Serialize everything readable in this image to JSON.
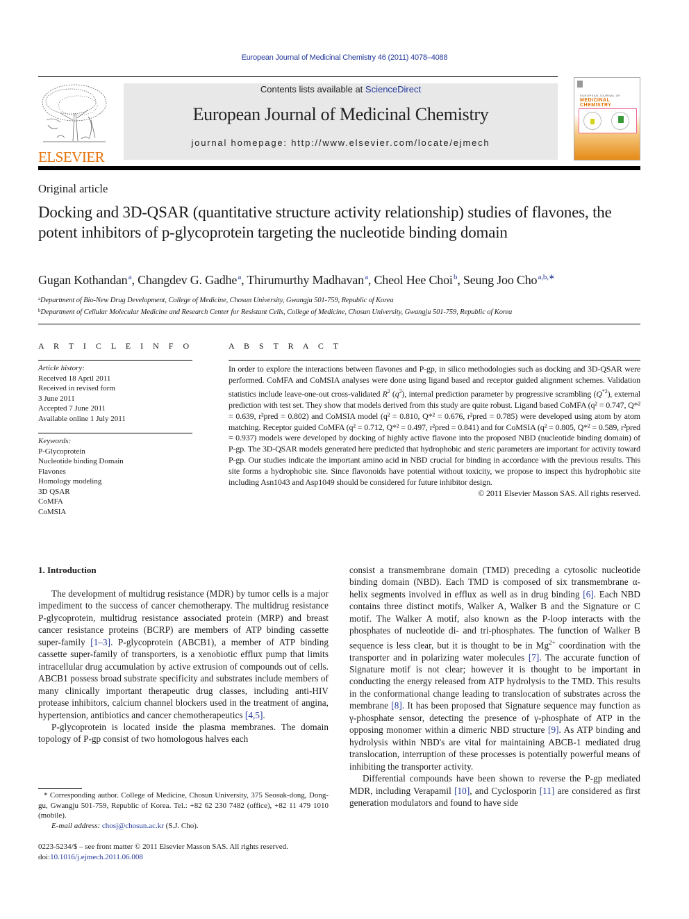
{
  "header": {
    "citation": "European Journal of Medicinal Chemistry 46 (2011) 4078–4088",
    "contents_prefix": "Contents lists available at ",
    "contents_link": "ScienceDirect",
    "journal_title": "European Journal of Medicinal Chemistry",
    "homepage": "journal homepage: http://www.elsevier.com/locate/ejmech",
    "publisher_logo_text": "ELSEVIER",
    "cover_title_small": "EUROPEAN JOURNAL OF",
    "cover_title_line1": "MEDICINAL",
    "cover_title_line2": "CHEMISTRY"
  },
  "article": {
    "type": "Original article",
    "title": "Docking and 3D-QSAR (quantitative structure activity relationship) studies of flavones, the potent inhibitors of p-glycoprotein targeting the nucleotide binding domain",
    "authors": [
      {
        "name": "Gugan Kothandan",
        "sup": "a"
      },
      {
        "name": "Changdev G. Gadhe",
        "sup": "a"
      },
      {
        "name": "Thirumurthy Madhavan",
        "sup": "a"
      },
      {
        "name": "Cheol Hee Choi",
        "sup": "b"
      },
      {
        "name": "Seung Joo Cho",
        "sup": "a,b,∗"
      }
    ],
    "affiliations": [
      {
        "sup": "a",
        "text": "Department of Bio-New Drug Development, College of Medicine, Chosun University, Gwangju 501-759, Republic of Korea"
      },
      {
        "sup": "b",
        "text": "Department of Cellular Molecular Medicine and Research Center for Resistant Cells, College of Medicine, Chosun University, Gwangju 501-759, Republic of Korea"
      }
    ]
  },
  "article_info": {
    "heading": "A R T I C L E   I N F O",
    "history_label": "Article history:",
    "history": [
      "Received 18 April 2011",
      "Received in revised form",
      "3 June 2011",
      "Accepted 7 June 2011",
      "Available online 1 July 2011"
    ],
    "keywords_label": "Keywords:",
    "keywords": [
      "P-Glycoprotein",
      "Nucleotide binding Domain",
      "Flavones",
      "Homology modeling",
      "3D QSAR",
      "CoMFA",
      "CoMSIA"
    ]
  },
  "abstract": {
    "heading": "A B S T R A C T",
    "p1": "In order to explore the interactions between flavones and P-gp, in silico methodologies such as docking and 3D-QSAR were performed. CoMFA and CoMSIA analyses were done using ligand based and receptor guided alignment schemes. Validation statistics include leave-one-out cross-validated ",
    "r2": "R",
    "p2": " (",
    "q2a": "q",
    "p3": "), internal prediction parameter by progressive scrambling (",
    "Q2a": "Q",
    "p4": "), external prediction with test set. They show that models derived from this study are quite robust. Ligand based CoMFA (q² = 0.747, Q*² = 0.639, r²pred = 0.802) and CoMSIA model (q² = 0.810, Q*² = 0.676, r²pred = 0.785) were developed using atom by atom matching. Receptor guided CoMFA (q² = 0.712, Q*² = 0.497, r²pred = 0.841) and for CoMSIA (q² = 0.805, Q*² = 0.589, r²pred = 0.937) models were developed by docking of highly active flavone into the proposed NBD (nucleotide binding domain) of P-gp. The 3D-QSAR models generated here predicted that hydrophobic and steric parameters are important for activity toward P-gp. Our studies indicate the important amino acid in NBD crucial for binding in accordance with the previous results. This site forms a hydrophobic site. Since flavonoids have potential without toxicity, we propose to inspect this hydrophobic site including Asn1043 and Asp1049 should be considered for future inhibitor design.",
    "stats": {
      "ligand_comfa": {
        "q2": 0.747,
        "Q_star2": 0.639,
        "r2_pred": 0.802
      },
      "ligand_comsia": {
        "q2": 0.81,
        "Q_star2": 0.676,
        "r2_pred": 0.785
      },
      "receptor_comfa": {
        "q2": 0.712,
        "Q_star2": 0.497,
        "r2_pred": 0.841
      },
      "receptor_comsia": {
        "q2": 0.805,
        "Q_star2": 0.589,
        "r2_pred": 0.937
      }
    },
    "copyright": "© 2011 Elsevier Masson SAS. All rights reserved."
  },
  "introduction": {
    "heading": "1.  Introduction",
    "left": {
      "p1_a": "The development of multidrug resistance (MDR) by tumor cells is a major impediment to the success of cancer chemotherapy. The multidrug resistance P-glycoprotein, multidrug resistance associated protein (MRP) and breast cancer resistance proteins (BCRP) are members of ATP binding cassette super-family ",
      "ref1": "[1–3]",
      "p1_b": ". P-glycoprotein (ABCB1), a member of ATP binding cassette super-family of transporters, is a xenobiotic efflux pump that limits intracellular drug accumulation by active extrusion of compounds out of cells. ABCB1 possess broad substrate specificity and substrates include members of many clinically important therapeutic drug classes, including anti-HIV protease inhibitors, calcium channel blockers used in the treatment of angina, hypertension, antibiotics and cancer chemotherapeutics ",
      "ref2": "[4,5]",
      "p1_c": ".",
      "p2": "P-glycoprotein is located inside the plasma membranes. The domain topology of P-gp consist of two homologous halves each"
    },
    "right": {
      "a": "consist a transmembrane domain (TMD) preceding a cytosolic nucleotide binding domain (NBD). Each TMD is composed of six transmembrane α-helix segments involved in efflux as well as in drug binding ",
      "ref6": "[6]",
      "b": ". Each NBD contains three distinct motifs, Walker A, Walker B and the Signature or C motif. The Walker A motif, also known as the P-loop interacts with the phosphates of nucleotide di- and tri-phosphates. The function of Walker B sequence is less clear, but it is thought to be in Mg",
      "mg_sup": "2+",
      "c": " coordination with the transporter and in polarizing water molecules ",
      "ref7": "[7]",
      "d": ". The accurate function of Signature motif is not clear; however it is thought to be important in conducting the energy released from ATP hydrolysis to the TMD. This results in the conformational change leading to translocation of substrates across the membrane ",
      "ref8": "[8]",
      "e": ". It has been proposed that Signature sequence may function as γ-phosphate sensor, detecting the presence of γ-phosphate of ATP in the opposing monomer within a dimeric NBD structure ",
      "ref9": "[9]",
      "f": ". As ATP binding and hydrolysis within NBD's are vital for maintaining ABCB-1 mediated drug translocation, interruption of these processes is potentially powerful means of inhibiting the transporter activity.",
      "p2_a": "Differential compounds have been shown to reverse the P-gp mediated MDR, including Verapamil ",
      "ref10": "[10]",
      "p2_b": ", and Cyclosporin ",
      "ref11": "[11]",
      "p2_c": " are considered as first generation modulators and found to have side"
    }
  },
  "footnote": {
    "corresponding": "* Corresponding author. College of Medicine, Chosun University, 375 Seosuk-dong, Dong-gu, Gwangju 501-759, Republic of Korea. Tel.: +82 62 230 7482 (office), +82 11 479 1010 (mobile).",
    "email_label": "E-mail address: ",
    "email": "chosj@chosun.ac.kr",
    "email_suffix": " (S.J. Cho).",
    "front_matter": "0223-5234/$ – see front matter © 2011 Elsevier Masson SAS. All rights reserved.",
    "doi_prefix": "doi:",
    "doi": "10.1016/j.ejmech.2011.06.008"
  },
  "colors": {
    "link": "#23389a",
    "elsevier_orange": "#e8730a",
    "banner_bg": "#e8e8e8"
  }
}
